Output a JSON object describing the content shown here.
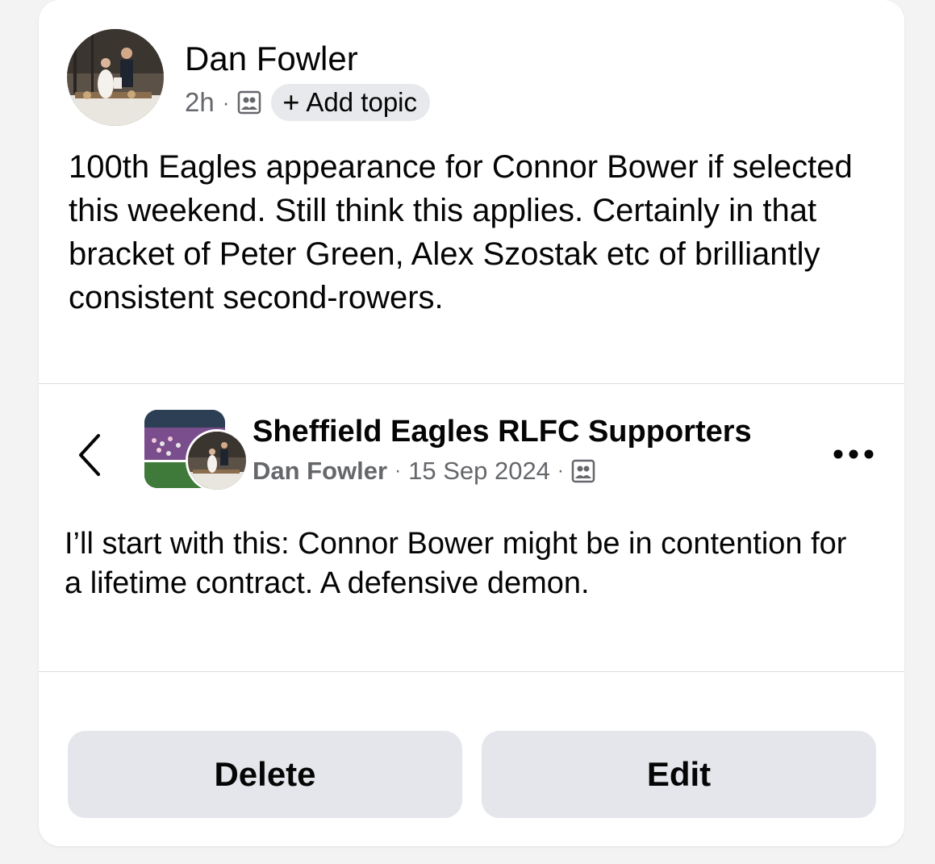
{
  "post": {
    "author": "Dan Fowler",
    "time": "2h",
    "separator": "·",
    "audience_icon": "group-audience-icon",
    "add_topic_plus": "+",
    "add_topic_label": "Add topic",
    "text": "100th Eagles appearance for Connor Bower if selected this weekend. Still think this applies. Certainly in that bracket of Peter Green, Alex Szostak etc of brilliantly consistent second-rowers."
  },
  "shared_post": {
    "group_name": "Sheffield Eagles RLFC Supporters",
    "author": "Dan Fowler",
    "date": "15 Sep 2024",
    "separator": "·",
    "audience_icon": "group-audience-icon",
    "text": "I’ll start with this: Connor Bower might be in contention for a lifetime contract. A defensive demon."
  },
  "actions": {
    "delete_label": "Delete",
    "edit_label": "Edit"
  },
  "colors": {
    "card_background": "#ffffff",
    "button_background": "#e4e6eb",
    "secondary_text": "#65676b",
    "primary_text": "#050505",
    "divider": "#dadde1"
  }
}
